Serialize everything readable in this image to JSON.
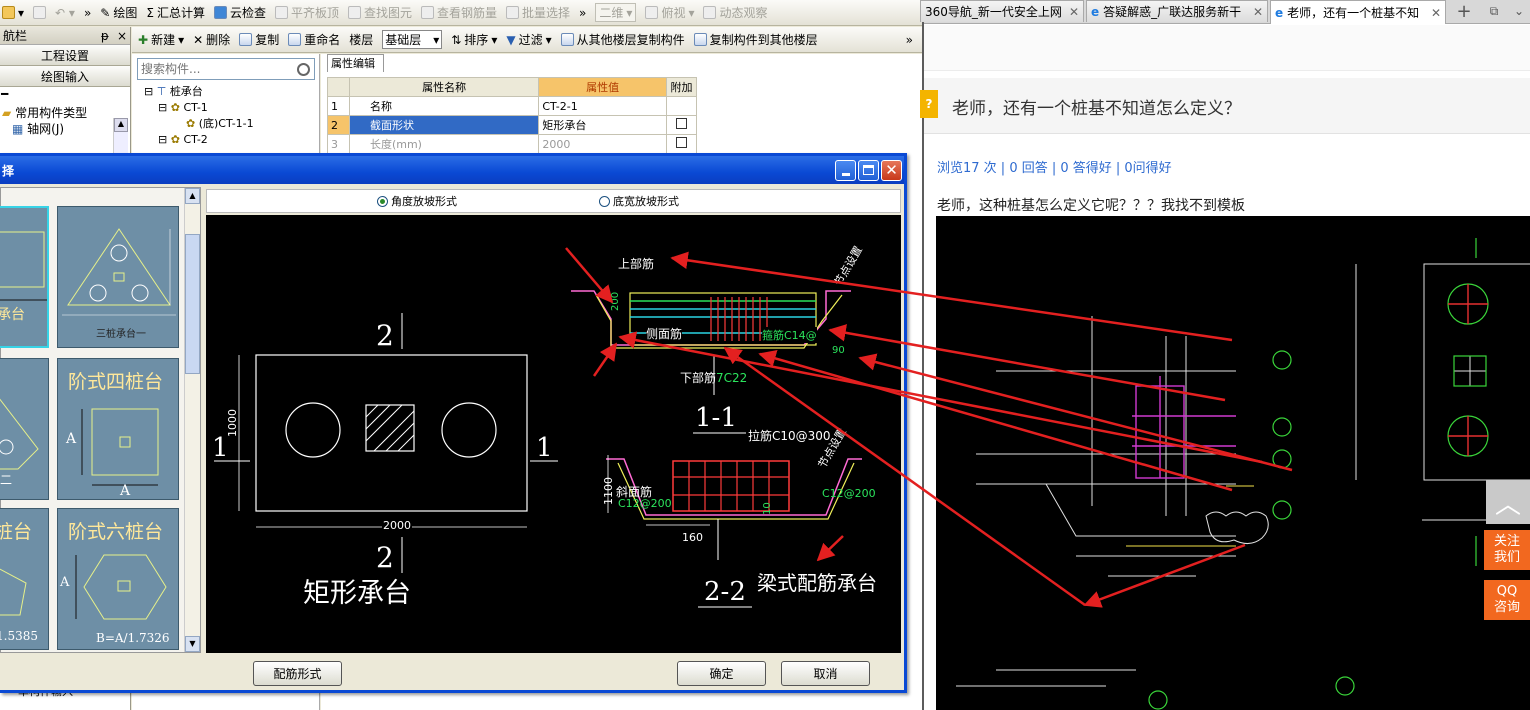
{
  "app": {
    "toolbar1": {
      "draw": "绘图",
      "summary": "汇总计算",
      "cloud_check": "云检查",
      "flat_slab": "平齐板顶",
      "find_element": "查找图元",
      "view_rebar": "查看钢筋量",
      "batch_select": "批量选择",
      "view_2d": "二维",
      "view_top": "俯视",
      "dynamic": "动态观察"
    },
    "nav": {
      "title": "航栏",
      "pin": "ᵽ",
      "close": "×",
      "project_settings": "工程设置",
      "drawing_input": "绘图输入",
      "common_types": "常用构件类型",
      "axis_grid": "轴网(J)",
      "single_input": "单构件输入"
    },
    "toolbar2": {
      "new": "新建",
      "delete": "删除",
      "copy": "复制",
      "rename": "重命名",
      "floor": "楼层",
      "floor_value": "基础层",
      "sort": "排序",
      "filter": "过滤",
      "copy_from": "从其他楼层复制构件",
      "copy_to": "复制构件到其他楼层"
    },
    "search_placeholder": "搜索构件...",
    "tree": {
      "root": "桩承台",
      "ct1": "CT-1",
      "ct1_child": "(底)CT-1-1",
      "ct2": "CT-2"
    },
    "props": {
      "tab": "属性编辑",
      "col_name": "属性名称",
      "col_value": "属性值",
      "col_extra": "附加",
      "rows": [
        {
          "no": "1",
          "name": "名称",
          "value": "CT-2-1"
        },
        {
          "no": "2",
          "name": "截面形状",
          "value": "矩形承台"
        },
        {
          "no": "3",
          "name": "长度(mm)",
          "value": "2000"
        }
      ]
    }
  },
  "dialog": {
    "title": "择",
    "radio_angle": "角度放坡形式",
    "radio_bottom": "底宽放坡形式",
    "thumbs": [
      {
        "title": "承台"
      },
      {
        "title": "三桩承台一"
      },
      {
        "title": "阶式四桩台",
        "a": "A"
      },
      {
        "title": "桩台",
        "b": "1.5385"
      },
      {
        "title": "阶式六桩台",
        "formula": "B=A/1.7326",
        "a": "A"
      },
      {
        "title": "二"
      }
    ],
    "main_cad": {
      "sec2": "2",
      "sec1": "1",
      "dim_1000": "1000",
      "dim_2000": "2000",
      "caption": "矩形承台",
      "sec11": "1-1",
      "sec22": "2-2",
      "top_rebar": "上部筋",
      "side_rebar": "侧面筋",
      "stirrup": "箍筋C14@",
      "bottom_rebar": "下部筋",
      "bottom_rebar_spec": "7C22",
      "tie": "拉筋C10@300",
      "slope_rebar": "斜面筋",
      "slope_spec": "C12@200",
      "right_spec": "C12@200",
      "beam_caption": "梁式配筋承台",
      "d200": "200",
      "d90": "90",
      "d1100": "1100",
      "d160": "160",
      "d10": "10",
      "slope_note": "节点设置"
    },
    "btn_rebar_form": "配筋形式",
    "btn_ok": "确定",
    "btn_cancel": "取消"
  },
  "browser": {
    "tabs": [
      {
        "label": "360导航_新一代安全上网"
      },
      {
        "label": "答疑解惑_广联达服务新干"
      },
      {
        "label": "老师，还有一个桩基不知"
      }
    ],
    "question_title": "老师，还有一个桩基不知道怎么定义？",
    "stats": "浏览17 次 | 0 回答 | 0 答得好 | 0问得好",
    "body": "老师，这种桩基怎么定义它呢？？？我找不到模板",
    "float_follow": "关注我们",
    "float_qq": "QQ咨询"
  },
  "colors": {
    "cad_bg": "#000000",
    "annotation_red": "#e32020",
    "title_blue": "#1f5fd0",
    "float_orange": "#f2681f"
  }
}
